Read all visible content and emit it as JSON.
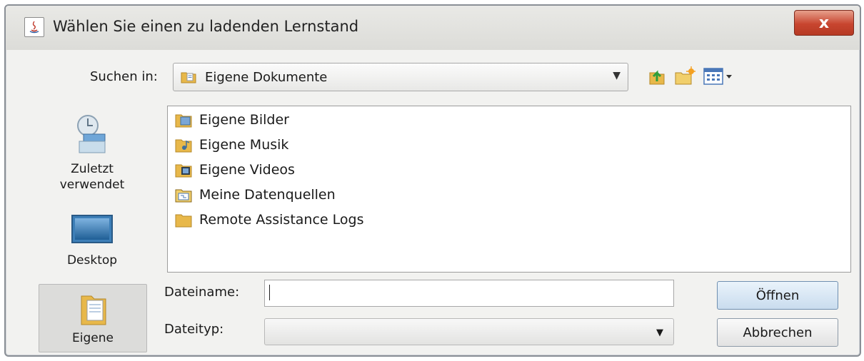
{
  "window": {
    "title": "Wählen Sie einen zu ladenden Lernstand",
    "close_glyph": "x"
  },
  "look_in": {
    "label": "Suchen in:",
    "value": "Eigene Dokumente"
  },
  "toolbar": {
    "icons": [
      "up-one-level-icon",
      "new-folder-icon",
      "view-menu-icon"
    ]
  },
  "places": [
    {
      "label_lines": [
        "Zuletzt",
        "verwendet"
      ],
      "icon": "recent-icon",
      "selected": false
    },
    {
      "label_lines": [
        "Desktop"
      ],
      "icon": "desktop-icon",
      "selected": false
    },
    {
      "label_lines": [
        "Eigene"
      ],
      "icon": "documents-icon",
      "selected": true
    }
  ],
  "files": [
    {
      "name": "Eigene Bilder",
      "icon": "pictures-folder-icon"
    },
    {
      "name": "Eigene Musik",
      "icon": "music-folder-icon"
    },
    {
      "name": "Eigene Videos",
      "icon": "videos-folder-icon"
    },
    {
      "name": "Meine Datenquellen",
      "icon": "datasources-folder-icon"
    },
    {
      "name": "Remote Assistance Logs",
      "icon": "folder-icon"
    }
  ],
  "filename": {
    "label": "Dateiname:",
    "value": ""
  },
  "filetype": {
    "label": "Dateityp:",
    "value": ""
  },
  "buttons": {
    "open": "Öffnen",
    "cancel": "Abbrechen"
  },
  "colors": {
    "close_button": "#c8452f",
    "open_button": "#c9dcee",
    "folder": "#e8b84a"
  }
}
